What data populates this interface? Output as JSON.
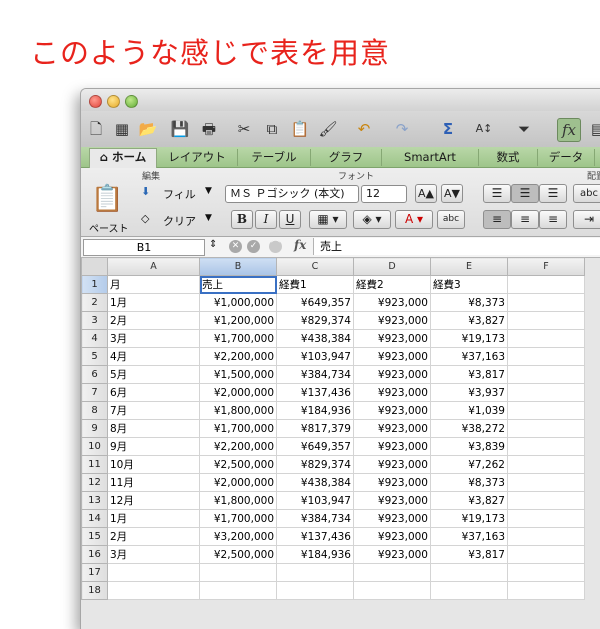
{
  "caption": "このような感じで表を用意",
  "toolbar": {
    "icons": [
      "new-document",
      "templates",
      "open",
      "save",
      "print",
      "cut",
      "copy",
      "paste",
      "format-painter",
      "undo",
      "redo",
      "autosum",
      "sort",
      "filter",
      "formula-builder"
    ]
  },
  "tabs": [
    "ホーム",
    "レイアウト",
    "テーブル",
    "グラフ",
    "SmartArt",
    "数式",
    "データ"
  ],
  "ribbon": {
    "edit_group": "編集",
    "font_group": "フォント",
    "align_group": "配置",
    "paste_label": "ペースト",
    "fill_label": "フィル",
    "clear_label": "クリア",
    "font_name": "ＭＳ Ｐゴシック (本文)",
    "font_size": "12",
    "bold": "B",
    "italic": "I",
    "underline": "U",
    "wrap_label": "abc"
  },
  "formula_bar": {
    "name_box": "B1",
    "fx": "fx",
    "content": "売上"
  },
  "sheet": {
    "columns": [
      "A",
      "B",
      "C",
      "D",
      "E",
      "F"
    ],
    "selected_cell": "B1",
    "rows": [
      [
        "月",
        "売上",
        "経費1",
        "経費2",
        "経費3",
        ""
      ],
      [
        "1月",
        "¥1,000,000",
        "¥649,357",
        "¥923,000",
        "¥8,373",
        ""
      ],
      [
        "2月",
        "¥1,200,000",
        "¥829,374",
        "¥923,000",
        "¥3,827",
        ""
      ],
      [
        "3月",
        "¥1,700,000",
        "¥438,384",
        "¥923,000",
        "¥19,173",
        ""
      ],
      [
        "4月",
        "¥2,200,000",
        "¥103,947",
        "¥923,000",
        "¥37,163",
        ""
      ],
      [
        "5月",
        "¥1,500,000",
        "¥384,734",
        "¥923,000",
        "¥3,817",
        ""
      ],
      [
        "6月",
        "¥2,000,000",
        "¥137,436",
        "¥923,000",
        "¥3,937",
        ""
      ],
      [
        "7月",
        "¥1,800,000",
        "¥184,936",
        "¥923,000",
        "¥1,039",
        ""
      ],
      [
        "8月",
        "¥1,700,000",
        "¥817,379",
        "¥923,000",
        "¥38,272",
        ""
      ],
      [
        "9月",
        "¥2,200,000",
        "¥649,357",
        "¥923,000",
        "¥3,839",
        ""
      ],
      [
        "10月",
        "¥2,500,000",
        "¥829,374",
        "¥923,000",
        "¥7,262",
        ""
      ],
      [
        "11月",
        "¥2,000,000",
        "¥438,384",
        "¥923,000",
        "¥8,373",
        ""
      ],
      [
        "12月",
        "¥1,800,000",
        "¥103,947",
        "¥923,000",
        "¥3,827",
        ""
      ],
      [
        "1月",
        "¥1,700,000",
        "¥384,734",
        "¥923,000",
        "¥19,173",
        ""
      ],
      [
        "2月",
        "¥3,200,000",
        "¥137,436",
        "¥923,000",
        "¥37,163",
        ""
      ],
      [
        "3月",
        "¥2,500,000",
        "¥184,936",
        "¥923,000",
        "¥3,817",
        ""
      ],
      [
        "",
        "",
        "",
        "",
        "",
        ""
      ],
      [
        "",
        "",
        "",
        "",
        "",
        ""
      ]
    ]
  }
}
